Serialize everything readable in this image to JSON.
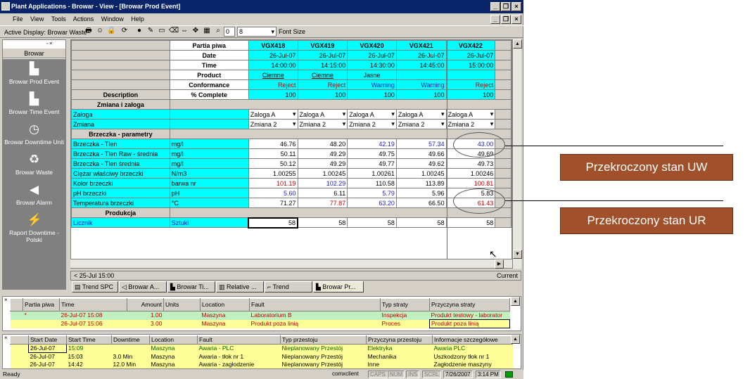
{
  "window": {
    "title": "Plant Applications - Browar - View - [Browar Prod Event]",
    "controls": [
      "_",
      "❐",
      "×"
    ]
  },
  "menu": [
    "File",
    "View",
    "Tools",
    "Actions",
    "Window",
    "Help"
  ],
  "toolbar": {
    "active_display": "Active Display: Browar Waste",
    "zoom_value": "8",
    "font_size_label": "Font Size"
  },
  "left_panel": {
    "title": "Browar",
    "items": [
      {
        "label": "Browar Prod Event",
        "icon": "building-icon"
      },
      {
        "label": "Browar Time Event",
        "icon": "building-icon"
      },
      {
        "label": "Browar Downtime Unit",
        "icon": "clock-icon"
      },
      {
        "label": "Browar Waste",
        "icon": "trash-icon"
      },
      {
        "label": "Browar Alarm",
        "icon": "speaker-icon"
      },
      {
        "label": "Raport Downtime - Polski",
        "icon": "lightning-icon"
      }
    ]
  },
  "grid": {
    "header_labels": [
      "Partia piwa",
      "Date",
      "Time",
      "Product",
      "Conformance",
      "% Complete"
    ],
    "description_label": "Description",
    "columns": [
      {
        "partia": "VGX418",
        "date": "26-Jul-07",
        "time": "14:00:00",
        "product": "Ciemne",
        "conformance": "Reject",
        "complete": "100"
      },
      {
        "partia": "VGX419",
        "date": "26-Jul-07",
        "time": "14:15:00",
        "product": "Ciemne",
        "conformance": "Reject",
        "complete": "100"
      },
      {
        "partia": "VGX420",
        "date": "26-Jul-07",
        "time": "14:30:00",
        "product": "Jasne",
        "conformance": "Warning",
        "complete": "100"
      },
      {
        "partia": "VGX421",
        "date": "26-Jul-07",
        "time": "14:45:00",
        "product": "",
        "conformance": "Warning",
        "complete": "100"
      },
      {
        "partia": "VGX422",
        "date": "26-Jul-07",
        "time": "15:00:00",
        "product": "",
        "conformance": "Reject",
        "complete": "100"
      }
    ],
    "sections": {
      "zmiana": "Zmiana i załoga",
      "brzeczka": "Brzeczka - parametry",
      "produkcja": "Produkcja"
    },
    "zmiana_rows": [
      {
        "name": "Załoga",
        "values": [
          "Zaloga A",
          "Zaloga A",
          "Zaloga A",
          "Zaloga A",
          "Zaloga A"
        ]
      },
      {
        "name": "Zmiana",
        "values": [
          "Zmiana 2",
          "Zmiana 2",
          "Zmiana 2",
          "Zmiana 2",
          "Zmiana 2"
        ]
      }
    ],
    "param_rows": [
      {
        "name": "Brzeczka - Tlen",
        "unit": "mg/l",
        "values": [
          "46.76",
          "48.20",
          "42.19",
          "57.34",
          "43.00"
        ]
      },
      {
        "name": "Brzeczka - Tlen Raw - średnia",
        "unit": "mg/l",
        "values": [
          "50.11",
          "49.29",
          "49.75",
          "49.66",
          "49.69"
        ]
      },
      {
        "name": "Brzeczka - Tlen średnia",
        "unit": "mg/l",
        "values": [
          "50.12",
          "49.29",
          "49.77",
          "49.62",
          "49.73"
        ]
      },
      {
        "name": "Ciężar właściwy brzeczki",
        "unit": "N/m3",
        "values": [
          "1.00255",
          "1.00245",
          "1.00261",
          "1.00245",
          "1.00246"
        ]
      },
      {
        "name": "Kolor brzeczki",
        "unit": "barwa nr",
        "values": [
          "101.19",
          "102.29",
          "110.58",
          "113.89",
          "100.81"
        ]
      },
      {
        "name": "pH brzeczki",
        "unit": "pH",
        "values": [
          "5.60",
          "6.11",
          "5.79",
          "5.96",
          "5.83"
        ]
      },
      {
        "name": "Temperatura brzeczki",
        "unit": "°C",
        "values": [
          "71.27",
          "77.87",
          "63.20",
          "66.50",
          "61.43"
        ]
      }
    ],
    "produkcja_row": {
      "name": "Licznik",
      "unit": "Sztuki",
      "values": [
        "58",
        "58",
        "58",
        "58",
        "58"
      ]
    }
  },
  "timebar": {
    "start": "< 25-Jul 15:00",
    "end": "Current"
  },
  "tabs": [
    "Trend SPC",
    "Browar A...",
    "Browar Ti...",
    "Relative ...",
    "Trend",
    "Browar Pr..."
  ],
  "waste_panel": {
    "headers": [
      "Partia piwa",
      "Time",
      "Amount",
      "Units",
      "Location",
      "Fault",
      "Typ straty",
      "Przyczyna straty"
    ],
    "rows": [
      {
        "partia": "*",
        "time": "26-Jul-07 15:08",
        "amount": "1.00",
        "units": "",
        "location": "Maszyna",
        "fault": "Laboratorium B",
        "typ": "Inspekcja",
        "przyczyna": "Produkt testowy - laborator"
      },
      {
        "partia": "",
        "time": "26-Jul-07 15:06",
        "amount": "3.00",
        "units": "",
        "location": "Maszyna",
        "fault": "Produkt poza linią",
        "typ": "Proces",
        "przyczyna": "Produkt poza linią"
      }
    ]
  },
  "downtime_panel": {
    "headers": [
      "Start Date",
      "Start Time",
      "Downtime",
      "Location",
      "Fault",
      "Typ przestoju",
      "Przyczyna przestoju",
      "Informacje szczegółowe"
    ],
    "rows": [
      {
        "date": "26-Jul-07",
        "time": "15:09",
        "downtime": "",
        "location": "Maszyna",
        "fault": "Awaria - PLC",
        "typ": "Nieplanowany Przestój",
        "przyczyna": "Elektryka",
        "info": "Awaria PLC"
      },
      {
        "date": "26-Jul-07",
        "time": "15:03",
        "downtime": "3.0 Min",
        "location": "Maszyna",
        "fault": "Awaria - tłok nr 1",
        "typ": "Nieplanowany Przestój",
        "przyczyna": "Mechanika",
        "info": "Uszkodzony tłok nr 1"
      },
      {
        "date": "26-Jul-07",
        "time": "14:42",
        "downtime": "12.0 Min",
        "location": "Maszyna",
        "fault": "Awaria - zagłodzenie",
        "typ": "Nieplanowany Przestój",
        "przyczyna": "Inne",
        "info": "Zagłodzenie maszyny"
      }
    ]
  },
  "statusbar": {
    "ready": "Ready",
    "client": "comxclient",
    "caps": "CAPS",
    "num": "NUM",
    "ins": "INS",
    "scrl": "SCRL",
    "date": "7/26/2007",
    "time": "3:14 PM"
  },
  "callouts": {
    "uw": "Przekroczony stan UW",
    "ur": "Przekroczony stan UR"
  },
  "colors": {
    "titlebar": "#0a246a",
    "cyan": "#00ffff",
    "callout": "#a0502a",
    "reject": "#c00000",
    "warning": "#2020c0"
  }
}
